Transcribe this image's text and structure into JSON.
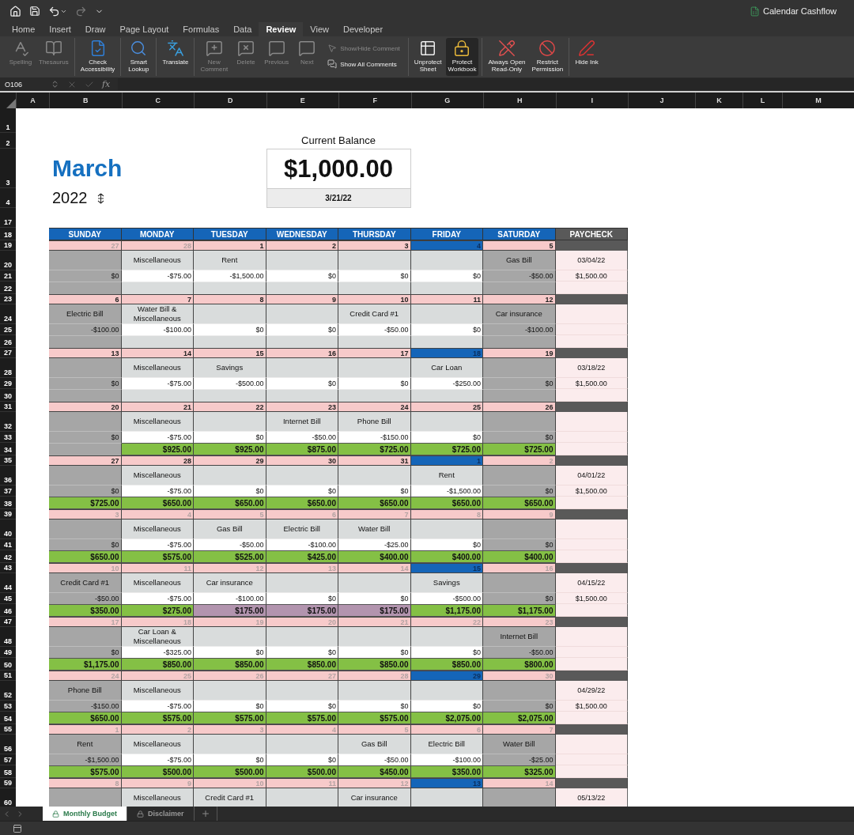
{
  "title_bar": {
    "document": "Calendar Cashflow"
  },
  "ribbon_tabs": [
    {
      "label": "Home",
      "selected": false
    },
    {
      "label": "Insert",
      "selected": false
    },
    {
      "label": "Draw",
      "selected": false
    },
    {
      "label": "Page Layout",
      "selected": false
    },
    {
      "label": "Formulas",
      "selected": false
    },
    {
      "label": "Data",
      "selected": false
    },
    {
      "label": "Review",
      "selected": true
    },
    {
      "label": "View",
      "selected": false
    },
    {
      "label": "Developer",
      "selected": false
    }
  ],
  "ribbon_groups": [
    {
      "items": [
        {
          "label": "Spelling",
          "kind": "large",
          "disabled": true,
          "on": false
        },
        {
          "label": "Thesaurus",
          "kind": "large",
          "disabled": true,
          "on": false
        }
      ]
    },
    {
      "items": [
        {
          "label": "Check\nAccessibility",
          "kind": "large",
          "disabled": false,
          "on": false
        }
      ]
    },
    {
      "items": [
        {
          "label": "Smart\nLookup",
          "kind": "large",
          "disabled": false,
          "on": false
        }
      ]
    },
    {
      "items": [
        {
          "label": "Translate",
          "kind": "large",
          "disabled": false,
          "on": false
        }
      ]
    },
    {
      "items": [
        {
          "label": "New\nComment",
          "kind": "large",
          "disabled": true,
          "on": false
        },
        {
          "label": "Delete",
          "kind": "large",
          "disabled": true,
          "on": false
        },
        {
          "label": "Previous",
          "kind": "large",
          "disabled": true,
          "on": false
        },
        {
          "label": "Next",
          "kind": "large",
          "disabled": true,
          "on": false
        },
        {
          "label": "Show/Hide Comment",
          "kind": "small",
          "disabled": true,
          "on": false
        },
        {
          "label": "Show All Comments",
          "kind": "small",
          "disabled": false,
          "on": false
        }
      ]
    },
    {
      "items": [
        {
          "label": "Unprotect\nSheet",
          "kind": "large",
          "disabled": false,
          "on": false
        },
        {
          "label": "Protect\nWorkbook",
          "kind": "large",
          "disabled": false,
          "on": true
        }
      ]
    },
    {
      "items": [
        {
          "label": "Always Open\nRead-Only",
          "kind": "large",
          "disabled": false,
          "on": false
        },
        {
          "label": "Restrict\nPermission",
          "kind": "large",
          "disabled": false,
          "on": false
        }
      ]
    },
    {
      "items": [
        {
          "label": "Hide Ink",
          "kind": "large",
          "disabled": false,
          "on": false
        }
      ]
    }
  ],
  "formula_bar": {
    "name_box": "O106",
    "function_label": "fx"
  },
  "columns": [
    "A",
    "B",
    "C",
    "D",
    "E",
    "F",
    "G",
    "H",
    "I",
    "J",
    "K",
    "L",
    "M"
  ],
  "top_rows": [
    "1",
    "2",
    "3",
    "4",
    "17",
    "18"
  ],
  "month": "March",
  "year": "2022",
  "balance_box": {
    "caption": "Current Balance",
    "amount": "$1,000.00",
    "date": "3/21/22"
  },
  "day_headers": [
    {
      "label": "SUNDAY",
      "weekend": true
    },
    {
      "label": "MONDAY",
      "weekend": false
    },
    {
      "label": "TUESDAY",
      "weekend": false
    },
    {
      "label": "WEDNESDAY",
      "weekend": false
    },
    {
      "label": "THURSDAY",
      "weekend": false
    },
    {
      "label": "FRIDAY",
      "weekend": false
    },
    {
      "label": "SATURDAY",
      "weekend": true
    }
  ],
  "paycheck_header": "PAYCHECK",
  "weeks": [
    {
      "rows": [
        "19",
        "20",
        "21",
        "22"
      ],
      "paycheck": {
        "date": "03/04/22",
        "amount": "$1,500.00"
      },
      "days": [
        {
          "date": "27",
          "faded": true,
          "payday": false,
          "amount": "$0"
        },
        {
          "date": "28",
          "faded": true,
          "payday": false,
          "label": "Miscellaneous",
          "amount": "-$75.00"
        },
        {
          "date": "1",
          "faded": false,
          "payday": false,
          "label": "Rent",
          "amount": "-$1,500.00"
        },
        {
          "date": "2",
          "faded": false,
          "payday": false,
          "amount": "$0"
        },
        {
          "date": "3",
          "faded": false,
          "payday": false,
          "amount": "$0"
        },
        {
          "date": "4",
          "faded": false,
          "payday": true,
          "amount": "$0"
        },
        {
          "date": "5",
          "faded": false,
          "payday": false,
          "label": "Gas Bill",
          "amount": "-$50.00"
        }
      ]
    },
    {
      "rows": [
        "23",
        "24",
        "25",
        "26"
      ],
      "days": [
        {
          "date": "6",
          "faded": false,
          "payday": false,
          "label": "Electric Bill",
          "amount": "-$100.00"
        },
        {
          "date": "7",
          "faded": false,
          "payday": false,
          "label": "Water Bill &\nMiscellaneous",
          "amount": "-$100.00"
        },
        {
          "date": "8",
          "faded": false,
          "payday": false,
          "amount": "$0"
        },
        {
          "date": "9",
          "faded": false,
          "payday": false,
          "amount": "$0"
        },
        {
          "date": "10",
          "faded": false,
          "payday": false,
          "label": "Credit Card #1",
          "amount": "-$50.00"
        },
        {
          "date": "11",
          "faded": false,
          "payday": false,
          "amount": "$0"
        },
        {
          "date": "12",
          "faded": false,
          "payday": false,
          "label": "Car insurance",
          "amount": "-$100.00"
        }
      ]
    },
    {
      "rows": [
        "27",
        "28",
        "29",
        "30"
      ],
      "paycheck": {
        "date": "03/18/22",
        "amount": "$1,500.00"
      },
      "days": [
        {
          "date": "13",
          "faded": false,
          "payday": false,
          "amount": "$0"
        },
        {
          "date": "14",
          "faded": false,
          "payday": false,
          "label": "Miscellaneous",
          "amount": "-$75.00"
        },
        {
          "date": "15",
          "faded": false,
          "payday": false,
          "label": "Savings",
          "amount": "-$500.00"
        },
        {
          "date": "16",
          "faded": false,
          "payday": false,
          "amount": "$0"
        },
        {
          "date": "17",
          "faded": false,
          "payday": false,
          "amount": "$0"
        },
        {
          "date": "18",
          "faded": false,
          "payday": true,
          "label": "Car Loan",
          "amount": "-$250.00"
        },
        {
          "date": "19",
          "faded": false,
          "payday": false,
          "amount": "$0"
        }
      ]
    },
    {
      "rows": [
        "31",
        "32",
        "33",
        "34"
      ],
      "days": [
        {
          "date": "20",
          "faded": false,
          "payday": false,
          "amount": "$0"
        },
        {
          "date": "21",
          "faded": false,
          "payday": false,
          "label": "Miscellaneous",
          "amount": "-$75.00",
          "balance": {
            "text": "$925.00",
            "low": false
          }
        },
        {
          "date": "22",
          "faded": false,
          "payday": false,
          "amount": "$0",
          "balance": {
            "text": "$925.00",
            "low": false
          }
        },
        {
          "date": "23",
          "faded": false,
          "payday": false,
          "label": "Internet Bill",
          "amount": "-$50.00",
          "balance": {
            "text": "$875.00",
            "low": false
          }
        },
        {
          "date": "24",
          "faded": false,
          "payday": false,
          "label": "Phone Bill",
          "amount": "-$150.00",
          "balance": {
            "text": "$725.00",
            "low": false
          }
        },
        {
          "date": "25",
          "faded": false,
          "payday": false,
          "amount": "$0",
          "balance": {
            "text": "$725.00",
            "low": false
          }
        },
        {
          "date": "26",
          "faded": false,
          "payday": false,
          "amount": "$0",
          "balance": {
            "text": "$725.00",
            "low": false
          }
        }
      ]
    },
    {
      "rows": [
        "35",
        "36",
        "37",
        "38"
      ],
      "paycheck": {
        "date": "04/01/22",
        "amount": "$1,500.00"
      },
      "days": [
        {
          "date": "27",
          "faded": false,
          "payday": false,
          "amount": "$0",
          "balance": {
            "text": "$725.00",
            "low": false
          }
        },
        {
          "date": "28",
          "faded": false,
          "payday": false,
          "label": "Miscellaneous",
          "amount": "-$75.00",
          "balance": {
            "text": "$650.00",
            "low": false
          }
        },
        {
          "date": "29",
          "faded": false,
          "payday": false,
          "amount": "$0",
          "balance": {
            "text": "$650.00",
            "low": false
          }
        },
        {
          "date": "30",
          "faded": false,
          "payday": false,
          "amount": "$0",
          "balance": {
            "text": "$650.00",
            "low": false
          }
        },
        {
          "date": "31",
          "faded": false,
          "payday": false,
          "amount": "$0",
          "balance": {
            "text": "$650.00",
            "low": false
          }
        },
        {
          "date": "1",
          "faded": false,
          "payday": true,
          "label": "Rent",
          "amount": "-$1,500.00",
          "balance": {
            "text": "$650.00",
            "low": false
          }
        },
        {
          "date": "2",
          "faded": true,
          "payday": false,
          "amount": "$0",
          "balance": {
            "text": "$650.00",
            "low": false
          }
        }
      ]
    },
    {
      "rows": [
        "39",
        "40",
        "41",
        "42"
      ],
      "days": [
        {
          "date": "3",
          "faded": true,
          "payday": false,
          "amount": "$0",
          "balance": {
            "text": "$650.00",
            "low": false
          }
        },
        {
          "date": "4",
          "faded": true,
          "payday": false,
          "label": "Miscellaneous",
          "amount": "-$75.00",
          "balance": {
            "text": "$575.00",
            "low": false
          }
        },
        {
          "date": "5",
          "faded": true,
          "payday": false,
          "label": "Gas Bill",
          "amount": "-$50.00",
          "balance": {
            "text": "$525.00",
            "low": false
          }
        },
        {
          "date": "6",
          "faded": true,
          "payday": false,
          "label": "Electric Bill",
          "amount": "-$100.00",
          "balance": {
            "text": "$425.00",
            "low": false
          }
        },
        {
          "date": "7",
          "faded": true,
          "payday": false,
          "label": "Water Bill",
          "amount": "-$25.00",
          "balance": {
            "text": "$400.00",
            "low": false
          }
        },
        {
          "date": "8",
          "faded": true,
          "payday": false,
          "amount": "$0",
          "balance": {
            "text": "$400.00",
            "low": false
          }
        },
        {
          "date": "9",
          "faded": true,
          "payday": false,
          "amount": "$0",
          "balance": {
            "text": "$400.00",
            "low": false
          }
        }
      ]
    },
    {
      "rows": [
        "43",
        "44",
        "45",
        "46"
      ],
      "paycheck": {
        "date": "04/15/22",
        "amount": "$1,500.00"
      },
      "days": [
        {
          "date": "10",
          "faded": true,
          "payday": false,
          "label": "Credit Card #1",
          "amount": "-$50.00",
          "balance": {
            "text": "$350.00",
            "low": false
          }
        },
        {
          "date": "11",
          "faded": true,
          "payday": false,
          "label": "Miscellaneous",
          "amount": "-$75.00",
          "balance": {
            "text": "$275.00",
            "low": false
          }
        },
        {
          "date": "12",
          "faded": true,
          "payday": false,
          "label": "Car insurance",
          "amount": "-$100.00",
          "balance": {
            "text": "$175.00",
            "low": true
          }
        },
        {
          "date": "13",
          "faded": true,
          "payday": false,
          "amount": "$0",
          "balance": {
            "text": "$175.00",
            "low": true
          }
        },
        {
          "date": "14",
          "faded": true,
          "payday": false,
          "amount": "$0",
          "balance": {
            "text": "$175.00",
            "low": true
          }
        },
        {
          "date": "15",
          "faded": false,
          "payday": true,
          "label": "Savings",
          "amount": "-$500.00",
          "balance": {
            "text": "$1,175.00",
            "low": false
          }
        },
        {
          "date": "16",
          "faded": true,
          "payday": false,
          "amount": "$0",
          "balance": {
            "text": "$1,175.00",
            "low": false
          }
        }
      ]
    },
    {
      "rows": [
        "47",
        "48",
        "49",
        "50"
      ],
      "days": [
        {
          "date": "17",
          "faded": true,
          "payday": false,
          "amount": "$0",
          "balance": {
            "text": "$1,175.00",
            "low": false
          }
        },
        {
          "date": "18",
          "faded": true,
          "payday": false,
          "label": "Car Loan &\nMiscellaneous",
          "amount": "-$325.00",
          "balance": {
            "text": "$850.00",
            "low": false
          }
        },
        {
          "date": "19",
          "faded": true,
          "payday": false,
          "amount": "$0",
          "balance": {
            "text": "$850.00",
            "low": false
          }
        },
        {
          "date": "20",
          "faded": true,
          "payday": false,
          "amount": "$0",
          "balance": {
            "text": "$850.00",
            "low": false
          }
        },
        {
          "date": "21",
          "faded": true,
          "payday": false,
          "amount": "$0",
          "balance": {
            "text": "$850.00",
            "low": false
          }
        },
        {
          "date": "22",
          "faded": true,
          "payday": false,
          "amount": "$0",
          "balance": {
            "text": "$850.00",
            "low": false
          }
        },
        {
          "date": "23",
          "faded": true,
          "payday": false,
          "label": "Internet Bill",
          "amount": "-$50.00",
          "balance": {
            "text": "$800.00",
            "low": false
          }
        }
      ]
    },
    {
      "rows": [
        "51",
        "52",
        "53",
        "54"
      ],
      "paycheck": {
        "date": "04/29/22",
        "amount": "$1,500.00"
      },
      "days": [
        {
          "date": "24",
          "faded": true,
          "payday": false,
          "label": "Phone Bill",
          "amount": "-$150.00",
          "balance": {
            "text": "$650.00",
            "low": false
          }
        },
        {
          "date": "25",
          "faded": true,
          "payday": false,
          "label": "Miscellaneous",
          "amount": "-$75.00",
          "balance": {
            "text": "$575.00",
            "low": false
          }
        },
        {
          "date": "26",
          "faded": true,
          "payday": false,
          "amount": "$0",
          "balance": {
            "text": "$575.00",
            "low": false
          }
        },
        {
          "date": "27",
          "faded": true,
          "payday": false,
          "amount": "$0",
          "balance": {
            "text": "$575.00",
            "low": false
          }
        },
        {
          "date": "28",
          "faded": true,
          "payday": false,
          "amount": "$0",
          "balance": {
            "text": "$575.00",
            "low": false
          }
        },
        {
          "date": "29",
          "faded": false,
          "payday": true,
          "amount": "$0",
          "balance": {
            "text": "$2,075.00",
            "low": false
          }
        },
        {
          "date": "30",
          "faded": true,
          "payday": false,
          "amount": "$0",
          "balance": {
            "text": "$2,075.00",
            "low": false
          }
        }
      ]
    },
    {
      "rows": [
        "55",
        "56",
        "57",
        "58"
      ],
      "days": [
        {
          "date": "1",
          "faded": true,
          "payday": false,
          "label": "Rent",
          "amount": "-$1,500.00",
          "balance": {
            "text": "$575.00",
            "low": false
          }
        },
        {
          "date": "2",
          "faded": true,
          "payday": false,
          "label": "Miscellaneous",
          "amount": "-$75.00",
          "balance": {
            "text": "$500.00",
            "low": false
          }
        },
        {
          "date": "3",
          "faded": true,
          "payday": false,
          "amount": "$0",
          "balance": {
            "text": "$500.00",
            "low": false
          }
        },
        {
          "date": "4",
          "faded": true,
          "payday": false,
          "amount": "$0",
          "balance": {
            "text": "$500.00",
            "low": false
          }
        },
        {
          "date": "5",
          "faded": true,
          "payday": false,
          "label": "Gas Bill",
          "amount": "-$50.00",
          "balance": {
            "text": "$450.00",
            "low": false
          }
        },
        {
          "date": "6",
          "faded": true,
          "payday": false,
          "label": "Electric Bill",
          "amount": "-$100.00",
          "balance": {
            "text": "$350.00",
            "low": false
          }
        },
        {
          "date": "7",
          "faded": true,
          "payday": false,
          "label": "Water Bill",
          "amount": "-$25.00",
          "balance": {
            "text": "$325.00",
            "low": false
          }
        }
      ]
    },
    {
      "rows": [
        "59",
        "60"
      ],
      "paycheck": {
        "date": "05/13/22"
      },
      "days": [
        {
          "date": "8",
          "faded": true,
          "payday": false
        },
        {
          "date": "9",
          "faded": true,
          "payday": false,
          "label": "Miscellaneous"
        },
        {
          "date": "10",
          "faded": true,
          "payday": false,
          "label": "Credit Card #1"
        },
        {
          "date": "11",
          "faded": true,
          "payday": false
        },
        {
          "date": "12",
          "faded": true,
          "payday": false,
          "label": "Car insurance"
        },
        {
          "date": "13",
          "faded": false,
          "payday": true
        },
        {
          "date": "14",
          "faded": true,
          "payday": false
        }
      ]
    }
  ],
  "sheet_tabs": [
    {
      "label": "Monthly Budget",
      "selected": true
    },
    {
      "label": "Disclaimer",
      "selected": false
    }
  ]
}
